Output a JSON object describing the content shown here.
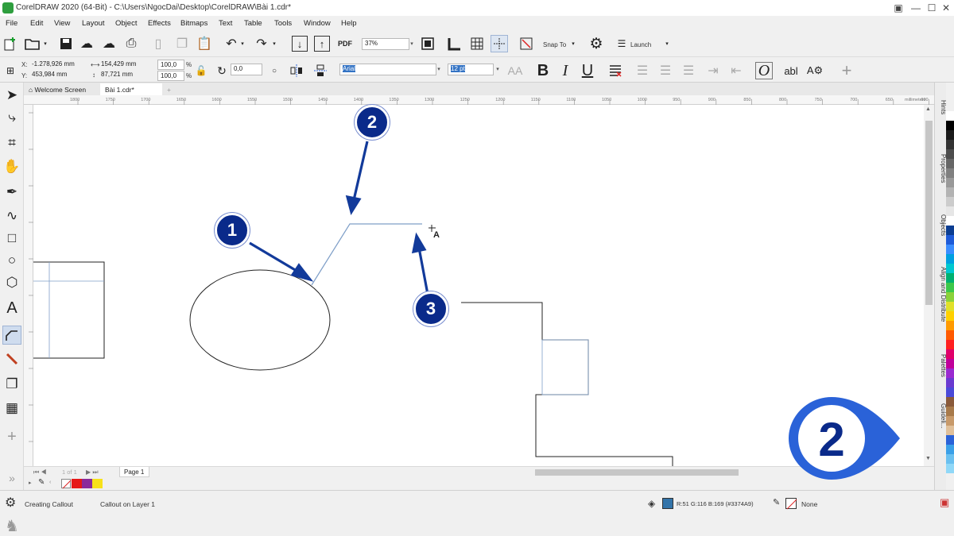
{
  "titlebar": {
    "title": "CorelDRAW 2020 (64-Bit) - C:\\Users\\NgocDai\\Desktop\\CorelDRAW\\Bài 1.cdr*"
  },
  "menu": [
    "File",
    "Edit",
    "View",
    "Layout",
    "Object",
    "Effects",
    "Bitmaps",
    "Text",
    "Table",
    "Tools",
    "Window",
    "Help"
  ],
  "toolbar": {
    "zoom": "37%",
    "snap_to": "Snap To",
    "launch": "Launch",
    "pdf": "PDF"
  },
  "propbar": {
    "x": "-1.278,926 mm",
    "y": "453,984 mm",
    "w": "154,429 mm",
    "h": "87,721 mm",
    "scale_x": "100,0",
    "scale_y": "100,0",
    "pct": "%",
    "angle": "0,0",
    "x_label": "X:",
    "y_label": "Y:",
    "font": "Arial",
    "size": "12 pt",
    "bold": "B",
    "italic": "I",
    "underline": "U",
    "frame_o": "O",
    "abl": "abl"
  },
  "tabs": {
    "welcome": "Welcome Screen",
    "doc": "Bài 1.cdr*",
    "add": "+"
  },
  "ruler_ticks": [
    "1800",
    "1750",
    "1700",
    "1650",
    "1600",
    "1550",
    "1500",
    "1450",
    "1400",
    "1350",
    "1300",
    "1250",
    "1200",
    "1150",
    "1100",
    "1050",
    "1000",
    "950",
    "900",
    "850",
    "800",
    "750",
    "700",
    "650",
    "600"
  ],
  "ruler_unit": "millimeters",
  "pagebar": {
    "page_label": "1 of 1",
    "page_name": "Page 1"
  },
  "dockers": [
    "Hints",
    "Properties",
    "Objects",
    "Align and Distribute",
    "Palettes",
    "Guideli..."
  ],
  "status": {
    "tool": "Creating Callout",
    "layer": "Callout on Layer 1",
    "fill": "R:51 G:116 B:169 (#3374A9)",
    "outline": "None",
    "fill_color": "#3374A9"
  },
  "annotations": {
    "one": "1",
    "two": "2",
    "three": "3",
    "brand": "2"
  },
  "colors": {
    "annotation": "#0a2a8a",
    "arrow": "#123a9a",
    "callout": "#7f9fc8",
    "brand": "#2a62d8"
  }
}
